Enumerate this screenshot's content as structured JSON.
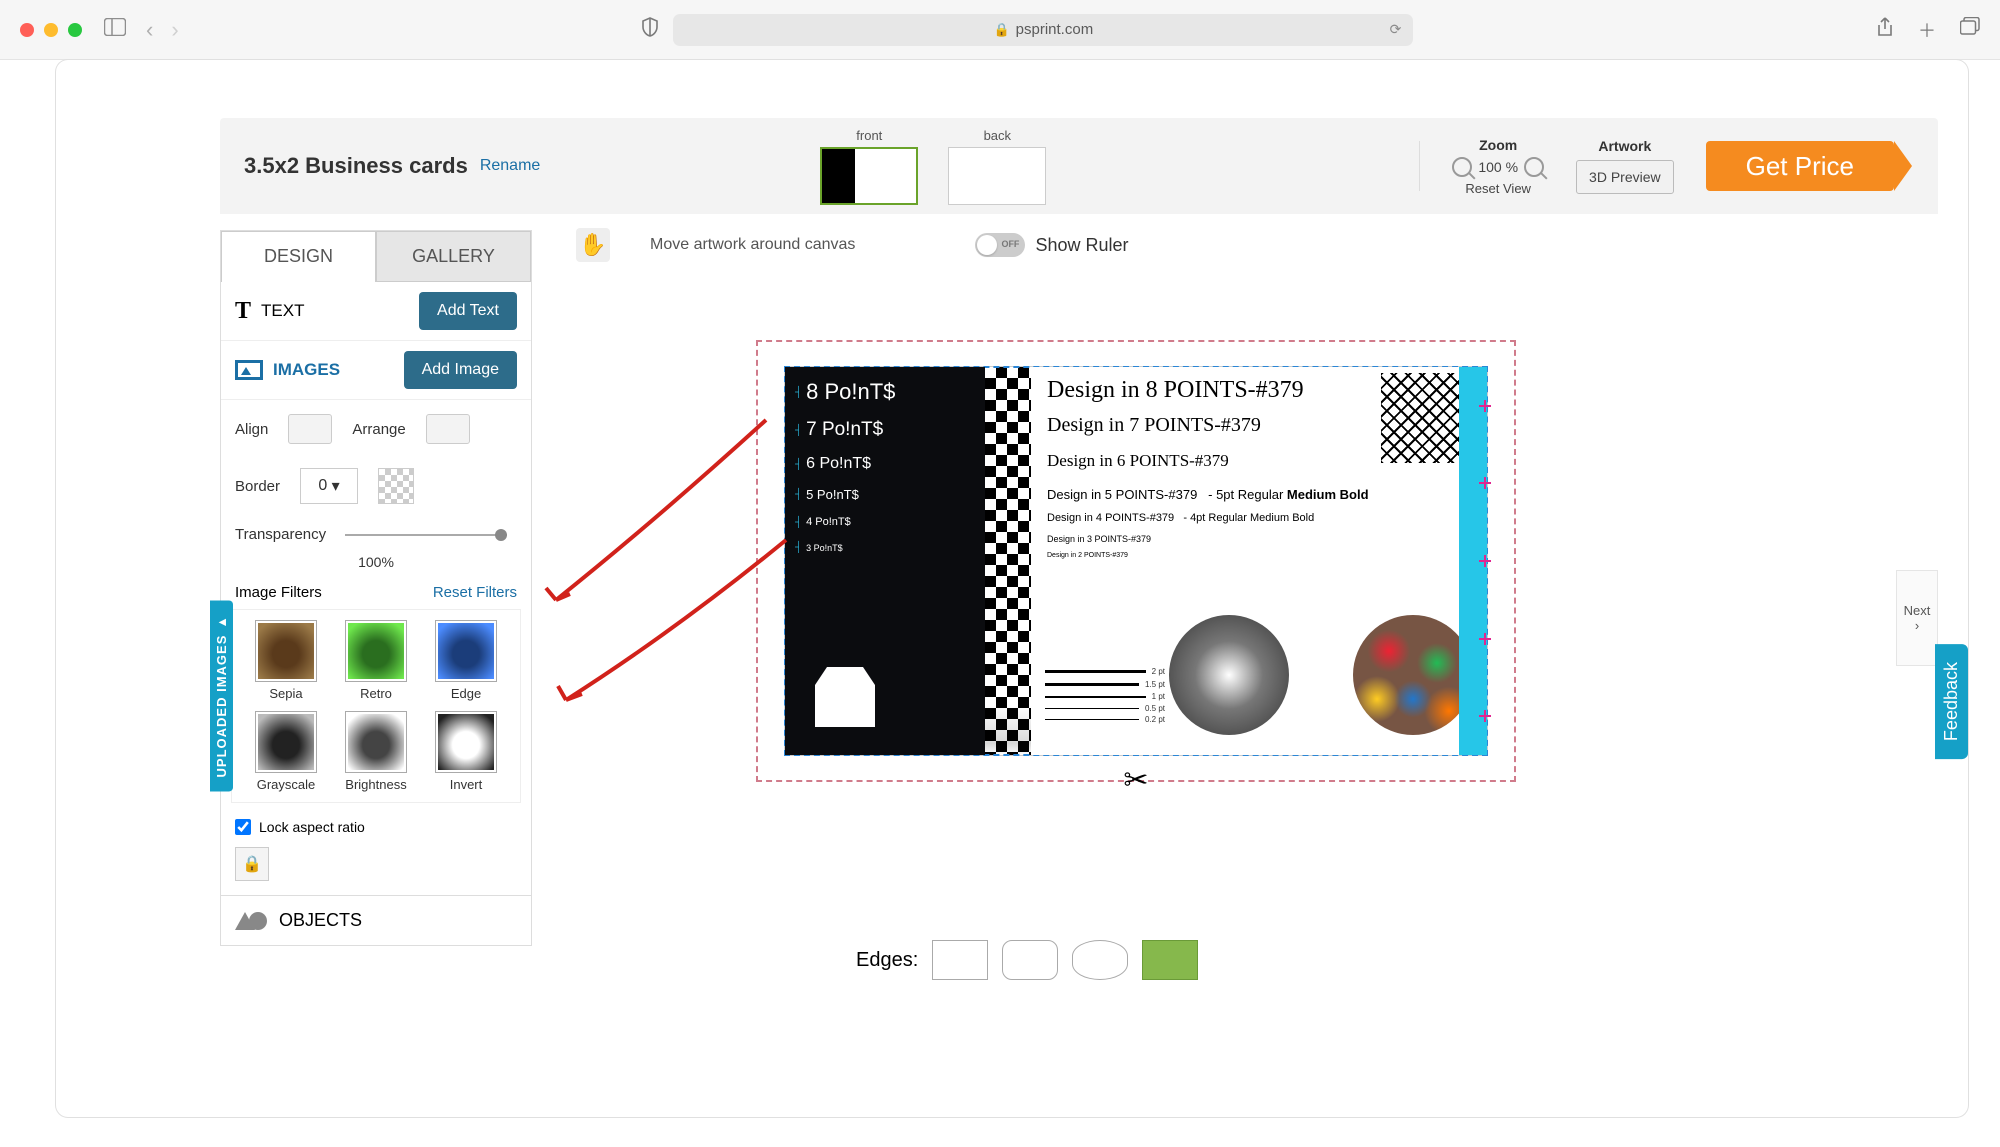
{
  "browser": {
    "url": "psprint.com"
  },
  "page": {
    "product_title": "3.5x2 Business cards",
    "rename": "Rename",
    "sides": {
      "front": "front",
      "back": "back"
    },
    "zoom": {
      "title": "Zoom",
      "value": "100 %",
      "reset": "Reset View"
    },
    "artwork": {
      "title": "Artwork",
      "preview": "3D Preview"
    },
    "get_price": "Get Price",
    "move_artwork": "Move artwork around canvas",
    "show_ruler": "Show Ruler",
    "next": "Next"
  },
  "tabs": {
    "design": "DESIGN",
    "gallery": "GALLERY"
  },
  "text_section": {
    "title": "TEXT",
    "button": "Add Text"
  },
  "images_section": {
    "title": "IMAGES",
    "button": "Add Image",
    "align": "Align",
    "arrange": "Arrange",
    "border": "Border",
    "border_value": "0",
    "transparency": "Transparency",
    "transparency_value": "100%",
    "filters_label": "Image Filters",
    "reset_filters": "Reset Filters",
    "filters": {
      "sepia": "Sepia",
      "retro": "Retro",
      "edge": "Edge",
      "grayscale": "Grayscale",
      "brightness": "Brightness",
      "invert": "Invert"
    },
    "lock_aspect": "Lock aspect ratio"
  },
  "objects_section": {
    "title": "OBJECTS"
  },
  "uploaded_tab": "UPLOADED IMAGES ▸",
  "feedback": "Feedback",
  "edges_label": "Edges:",
  "canvas": {
    "l8": "8 Po!nT$",
    "l7": "7 Po!nT$",
    "l6": "6 Po!nT$",
    "l5": "5 Po!nT$",
    "l4": "4 Po!nT$",
    "l3": "3 Po!nT$",
    "r8": "Design in 8 POINTS-#379",
    "r7": "Design in 7 POINTS-#379",
    "r6": "Design in 6 POINTS-#379",
    "r5": "Design in 5 POINTS-#379",
    "r5b": "- 5pt Regular",
    "r5m": "Medium",
    "r5s": "Bold",
    "r4": "Design in 4 POINTS-#379",
    "r4b": "- 4pt Regular",
    "r4m": "Medium",
    "r4s": "Bold",
    "r3": "Design in 3 POINTS-#379",
    "r2": "Design in 2 POINTS-#379",
    "pt": [
      "2 pt",
      "1.5 pt",
      "1 pt",
      "0.5 pt",
      "0.2 pt"
    ]
  }
}
